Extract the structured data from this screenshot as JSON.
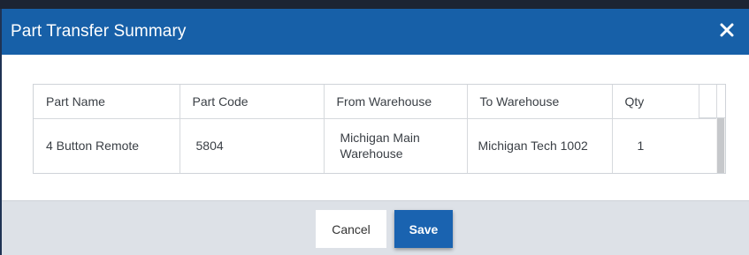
{
  "modal": {
    "title": "Part Transfer Summary",
    "close_icon": "close-icon"
  },
  "table": {
    "headers": [
      "Part Name",
      "Part Code",
      "From Warehouse",
      "To Warehouse",
      "Qty"
    ],
    "rows": [
      {
        "part_name": "4 Button Remote",
        "part_code": "5804",
        "from_warehouse": "Michigan Main Warehouse",
        "to_warehouse": "Michigan Tech 1002",
        "qty": "1"
      }
    ]
  },
  "footer": {
    "cancel_label": "Cancel",
    "save_label": "Save"
  },
  "colors": {
    "header_bg": "#1760a8",
    "save_button_bg": "#1a63b0",
    "footer_bg": "#dde1e7"
  }
}
